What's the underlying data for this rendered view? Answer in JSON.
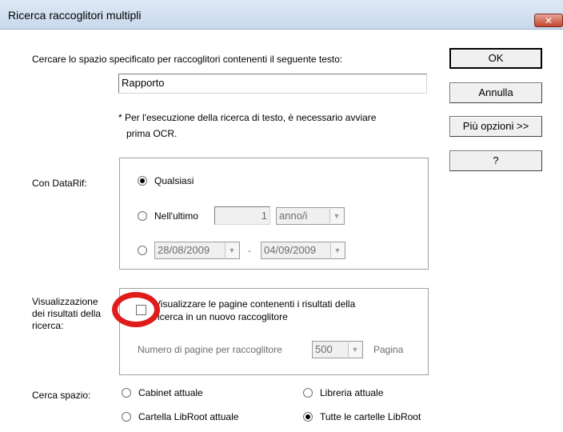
{
  "window": {
    "title": "Ricerca raccoglitori multipli"
  },
  "search": {
    "prompt": "Cercare lo spazio specificato per raccoglitori contenenti il seguente testo:",
    "value": "Rapporto",
    "note_line1": "* Per l'esecuzione della ricerca di testo, è necessario avviare",
    "note_line2": "prima OCR."
  },
  "buttons": {
    "ok": "OK",
    "cancel": "Annulla",
    "more": "Più opzioni >>",
    "help": "?"
  },
  "date_ref": {
    "label": "Con DataRif:",
    "any": "Qualsiasi",
    "last": "Nell'ultimo",
    "last_value": "1",
    "last_unit": "anno/i",
    "date_from": "28/08/2009",
    "separator": "-",
    "date_to": "04/09/2009",
    "selected": "any"
  },
  "results": {
    "label_line1": "Visualizzazione",
    "label_line2": "dei risultati della",
    "label_line3": "ricerca:",
    "checkbox_line1": "Visualizzare le pagine contenenti i risultati della",
    "checkbox_line2": "ricerca in un nuovo raccoglitore",
    "checked": false,
    "pages_label": "Numero di pagine per raccoglitore",
    "pages_value": "500",
    "pages_unit": "Pagina"
  },
  "scope": {
    "label": "Cerca spazio:",
    "cabinet": "Cabinet attuale",
    "library": "Libreria attuale",
    "libroot_folder": "Cartella LibRoot attuale",
    "all_libroot": "Tutte le cartelle LibRoot",
    "selected": "all_libroot"
  },
  "colors": {
    "annotation": "#e01b1b"
  }
}
